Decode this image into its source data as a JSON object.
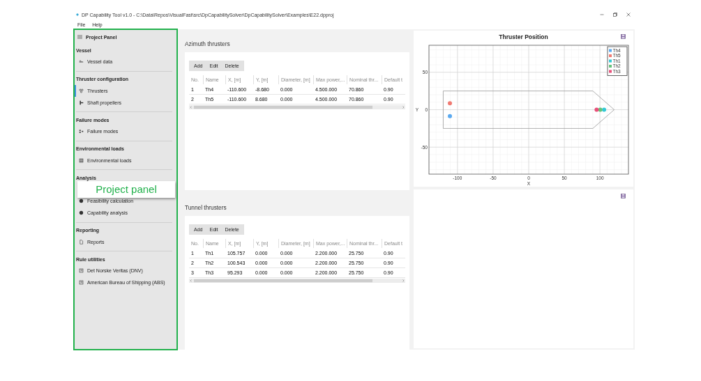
{
  "window": {
    "title": "DP Capability Tool v1.0 - C:\\Data\\Repos\\VisualFast\\src\\DpCapabilitySolver\\DpCapabilitySolver\\Examples\\E22.dpproj"
  },
  "menu": [
    "File",
    "Help"
  ],
  "sidebar": {
    "header": "Project Panel",
    "sections": [
      {
        "title": "Vessel",
        "items": [
          {
            "label": "Vessel data",
            "selected": false
          }
        ]
      },
      {
        "title": "Thruster configuration",
        "items": [
          {
            "label": "Thrusters",
            "selected": true
          },
          {
            "label": "Shaft propellers",
            "selected": false
          }
        ]
      },
      {
        "title": "Failure modes",
        "items": [
          {
            "label": "Failure modes",
            "selected": false
          }
        ]
      },
      {
        "title": "Environmental loads",
        "items": [
          {
            "label": "Environmental loads",
            "selected": false
          }
        ]
      },
      {
        "title": "Analysis",
        "callout": "Project panel",
        "items": [
          {
            "label": "Feasibility calculation",
            "selected": false
          },
          {
            "label": "Capability analysis",
            "selected": false
          }
        ]
      },
      {
        "title": "Reporting",
        "items": [
          {
            "label": "Reports",
            "selected": false
          }
        ]
      },
      {
        "title": "Rule utilities",
        "items": [
          {
            "label": "Det Norske Veritas (DNV)",
            "selected": false
          },
          {
            "label": "American Bureau of Shipping (ABS)",
            "selected": false
          }
        ]
      }
    ]
  },
  "tables": [
    {
      "title": "Azimuth thrusters",
      "toolbar": [
        "Add",
        "Edit",
        "Delete"
      ],
      "columns": [
        "No.",
        "Name",
        "X, [m]",
        "Y, [m]",
        "Diameter, [m]",
        "Max power,...",
        "Nominal thr...",
        "Default t"
      ],
      "rows": [
        [
          "1",
          "Th4",
          "-110.600",
          "-8.680",
          "0.000",
          "4.500.000",
          "70.860",
          "0.90"
        ],
        [
          "2",
          "Th5",
          "-110.600",
          "8.680",
          "0.000",
          "4.500.000",
          "70.860",
          "0.90"
        ]
      ]
    },
    {
      "title": "Tunnel thrusters",
      "toolbar": [
        "Add",
        "Edit",
        "Delete"
      ],
      "columns": [
        "No.",
        "Name",
        "X, [m]",
        "Y, [m]",
        "Diameter, [m]",
        "Max power,...",
        "Nominal thr...",
        "Default t"
      ],
      "rows": [
        [
          "1",
          "Th1",
          "105.757",
          "0.000",
          "0.000",
          "2.200.000",
          "25.750",
          "0.90"
        ],
        [
          "2",
          "Th2",
          "100.543",
          "0.000",
          "0.000",
          "2.200.000",
          "25.750",
          "0.90"
        ],
        [
          "3",
          "Th3",
          "95.293",
          "0.000",
          "0.000",
          "2.200.000",
          "25.750",
          "0.90"
        ]
      ]
    }
  ],
  "chart": {
    "chart_data": {
      "type": "scatter",
      "title": "Thruster Position",
      "xlabel": "X",
      "ylabel": "Y",
      "xlim": [
        -140,
        140
      ],
      "ylim": [
        -86,
        86
      ],
      "xticks": [
        -100,
        -50,
        0,
        50,
        100
      ],
      "yticks": [
        -50,
        0,
        50
      ],
      "grid": true,
      "legend": "top right",
      "x": [
        -110.6,
        95.3,
        100.5,
        105.8
      ],
      "series": [
        {
          "name": "Th4",
          "color": "#5aa9f0",
          "values": [
            -8.7,
            null,
            null,
            null
          ]
        },
        {
          "name": "Th5",
          "color": "#f07a72",
          "values": [
            8.7,
            null,
            null,
            null
          ]
        },
        {
          "name": "Th1",
          "color": "#33c9d6",
          "values": [
            null,
            null,
            null,
            0
          ]
        },
        {
          "name": "Th2",
          "color": "#66c27a",
          "values": [
            null,
            null,
            0,
            null
          ]
        },
        {
          "name": "Th3",
          "color": "#e8507a",
          "values": [
            null,
            0,
            null,
            null
          ]
        }
      ]
    }
  }
}
